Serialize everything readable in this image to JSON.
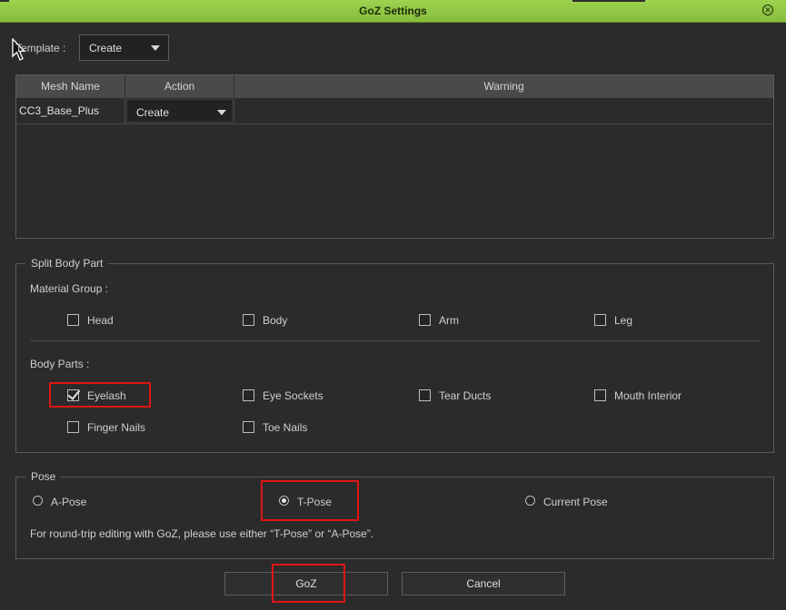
{
  "window": {
    "title": "GoZ Settings",
    "close_icon": "close-circle-icon",
    "accent": "#8bc34a"
  },
  "template": {
    "label": "Template :",
    "value": "Create"
  },
  "table": {
    "headers": [
      "Mesh Name",
      "Action",
      "Warning"
    ],
    "rows": [
      {
        "mesh_name": "CC3_Base_Plus",
        "action": "Create",
        "warning": ""
      }
    ]
  },
  "split": {
    "title": "Split Body Part",
    "material_group_label": "Material Group :",
    "material_group": [
      {
        "label": "Head",
        "checked": false
      },
      {
        "label": "Body",
        "checked": false
      },
      {
        "label": "Arm",
        "checked": false
      },
      {
        "label": "Leg",
        "checked": false
      }
    ],
    "body_parts_label": "Body Parts :",
    "body_parts": [
      {
        "label": "Eyelash",
        "checked": true
      },
      {
        "label": "Eye Sockets",
        "checked": false
      },
      {
        "label": "Tear Ducts",
        "checked": false
      },
      {
        "label": "Mouth Interior",
        "checked": false
      },
      {
        "label": "Finger Nails",
        "checked": false
      },
      {
        "label": "Toe Nails",
        "checked": false
      }
    ]
  },
  "pose": {
    "title": "Pose",
    "options": [
      {
        "label": "A-Pose",
        "selected": false
      },
      {
        "label": "T-Pose",
        "selected": true
      },
      {
        "label": "Current Pose",
        "selected": false
      }
    ],
    "note": "For round-trip editing with GoZ, please use either “T-Pose” or “A-Pose”."
  },
  "buttons": {
    "goz": "GoZ",
    "cancel": "Cancel"
  },
  "highlight_color": "#e01515"
}
